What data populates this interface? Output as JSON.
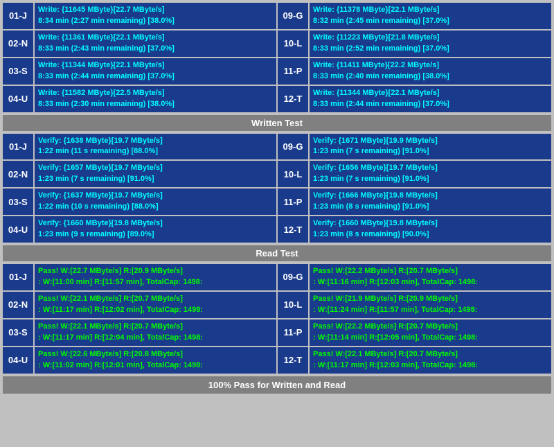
{
  "sections": {
    "write": {
      "rows": [
        {
          "left_id": "01-J",
          "left_line1": "Write: {11645 MByte}[22.7 MByte/s]",
          "left_line2": "8:34 min (2:27 min remaining)  [38.0%]",
          "right_id": "09-G",
          "right_line1": "Write: {11378 MByte}[22.1 MByte/s]",
          "right_line2": "8:32 min (2:45 min remaining)  [37.0%]"
        },
        {
          "left_id": "02-N",
          "left_line1": "Write: {11361 MByte}[22.1 MByte/s]",
          "left_line2": "8:33 min (2:43 min remaining)  [37.0%]",
          "right_id": "10-L",
          "right_line1": "Write: {11223 MByte}[21.8 MByte/s]",
          "right_line2": "8:33 min (2:52 min remaining)  [37.0%]"
        },
        {
          "left_id": "03-S",
          "left_line1": "Write: {11344 MByte}[22.1 MByte/s]",
          "left_line2": "8:33 min (2:44 min remaining)  [37.0%]",
          "right_id": "11-P",
          "right_line1": "Write: {11411 MByte}[22.2 MByte/s]",
          "right_line2": "8:33 min (2:40 min remaining)  [38.0%]"
        },
        {
          "left_id": "04-U",
          "left_line1": "Write: {11582 MByte}[22.5 MByte/s]",
          "left_line2": "8:33 min (2:30 min remaining)  [38.0%]",
          "right_id": "12-T",
          "right_line1": "Write: {11344 MByte}[22.1 MByte/s]",
          "right_line2": "8:33 min (2:44 min remaining)  [37.0%]"
        }
      ],
      "header": "Written Test"
    },
    "verify": {
      "rows": [
        {
          "left_id": "01-J",
          "left_line1": "Verify: {1638 MByte}[19.7 MByte/s]",
          "left_line2": "1:22 min (11 s remaining)  [88.0%]",
          "right_id": "09-G",
          "right_line1": "Verify: {1671 MByte}[19.9 MByte/s]",
          "right_line2": "1:23 min (7 s remaining)  [91.0%]"
        },
        {
          "left_id": "02-N",
          "left_line1": "Verify: {1657 MByte}[19.7 MByte/s]",
          "left_line2": "1:23 min (7 s remaining)  [91.0%]",
          "right_id": "10-L",
          "right_line1": "Verify: {1656 MByte}[19.7 MByte/s]",
          "right_line2": "1:23 min (7 s remaining)  [91.0%]"
        },
        {
          "left_id": "03-S",
          "left_line1": "Verify: {1637 MByte}[19.7 MByte/s]",
          "left_line2": "1:22 min (10 s remaining)  [88.0%]",
          "right_id": "11-P",
          "right_line1": "Verify: {1666 MByte}[19.8 MByte/s]",
          "right_line2": "1:23 min (8 s remaining)  [91.0%]"
        },
        {
          "left_id": "04-U",
          "left_line1": "Verify: {1660 MByte}[19.8 MByte/s]",
          "left_line2": "1:23 min (9 s remaining)  [89.0%]",
          "right_id": "12-T",
          "right_line1": "Verify: {1660 MByte}[19.8 MByte/s]",
          "right_line2": "1:23 min (8 s remaining)  [90.0%]"
        }
      ],
      "header": "Read Test"
    },
    "read": {
      "rows": [
        {
          "left_id": "01-J",
          "left_line1": "Pass! W:[22.7 MByte/s] R:[20.9 MByte/s]",
          "left_line2": ": W:[11:00 min] R:[11:57 min], TotalCap: 1498:",
          "right_id": "09-G",
          "right_line1": "Pass! W:[22.2 MByte/s] R:[20.7 MByte/s]",
          "right_line2": ": W:[11:16 min] R:[12:03 min], TotalCap: 1498:"
        },
        {
          "left_id": "02-N",
          "left_line1": "Pass! W:[22.1 MByte/s] R:[20.7 MByte/s]",
          "left_line2": ": W:[11:17 min] R:[12:02 min], TotalCap: 1498:",
          "right_id": "10-L",
          "right_line1": "Pass! W:[21.9 MByte/s] R:[20.9 MByte/s]",
          "right_line2": ": W:[11:24 min] R:[11:57 min], TotalCap: 1498:"
        },
        {
          "left_id": "03-S",
          "left_line1": "Pass! W:[22.1 MByte/s] R:[20.7 MByte/s]",
          "left_line2": ": W:[11:17 min] R:[12:04 min], TotalCap: 1498:",
          "right_id": "11-P",
          "right_line1": "Pass! W:[22.2 MByte/s] R:[20.7 MByte/s]",
          "right_line2": ": W:[11:14 min] R:[12:05 min], TotalCap: 1498:"
        },
        {
          "left_id": "04-U",
          "left_line1": "Pass! W:[22.6 MByte/s] R:[20.8 MByte/s]",
          "left_line2": ": W:[11:02 min] R:[12:01 min], TotalCap: 1498:",
          "right_id": "12-T",
          "right_line1": "Pass! W:[22.1 MByte/s] R:[20.7 MByte/s]",
          "right_line2": ": W:[11:17 min] R:[12:03 min], TotalCap: 1498:"
        }
      ]
    }
  },
  "headers": {
    "written_test": "Written Test",
    "read_test": "Read Test",
    "footer": "100% Pass for Written and Read"
  }
}
